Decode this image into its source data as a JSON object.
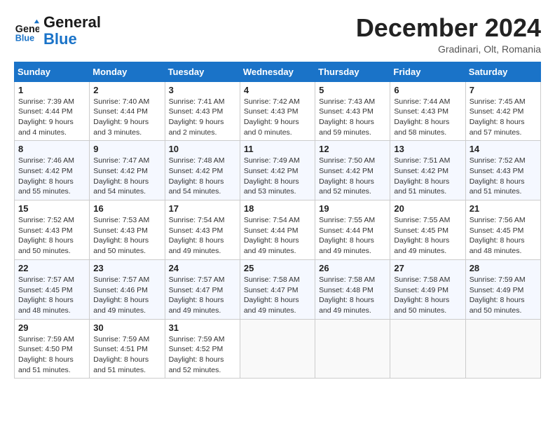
{
  "header": {
    "logo_line1": "General",
    "logo_line2": "Blue",
    "month_title": "December 2024",
    "location": "Gradinari, Olt, Romania"
  },
  "weekdays": [
    "Sunday",
    "Monday",
    "Tuesday",
    "Wednesday",
    "Thursday",
    "Friday",
    "Saturday"
  ],
  "weeks": [
    [
      {
        "day": "1",
        "info": "Sunrise: 7:39 AM\nSunset: 4:44 PM\nDaylight: 9 hours and 4 minutes."
      },
      {
        "day": "2",
        "info": "Sunrise: 7:40 AM\nSunset: 4:44 PM\nDaylight: 9 hours and 3 minutes."
      },
      {
        "day": "3",
        "info": "Sunrise: 7:41 AM\nSunset: 4:43 PM\nDaylight: 9 hours and 2 minutes."
      },
      {
        "day": "4",
        "info": "Sunrise: 7:42 AM\nSunset: 4:43 PM\nDaylight: 9 hours and 0 minutes."
      },
      {
        "day": "5",
        "info": "Sunrise: 7:43 AM\nSunset: 4:43 PM\nDaylight: 8 hours and 59 minutes."
      },
      {
        "day": "6",
        "info": "Sunrise: 7:44 AM\nSunset: 4:43 PM\nDaylight: 8 hours and 58 minutes."
      },
      {
        "day": "7",
        "info": "Sunrise: 7:45 AM\nSunset: 4:42 PM\nDaylight: 8 hours and 57 minutes."
      }
    ],
    [
      {
        "day": "8",
        "info": "Sunrise: 7:46 AM\nSunset: 4:42 PM\nDaylight: 8 hours and 55 minutes."
      },
      {
        "day": "9",
        "info": "Sunrise: 7:47 AM\nSunset: 4:42 PM\nDaylight: 8 hours and 54 minutes."
      },
      {
        "day": "10",
        "info": "Sunrise: 7:48 AM\nSunset: 4:42 PM\nDaylight: 8 hours and 54 minutes."
      },
      {
        "day": "11",
        "info": "Sunrise: 7:49 AM\nSunset: 4:42 PM\nDaylight: 8 hours and 53 minutes."
      },
      {
        "day": "12",
        "info": "Sunrise: 7:50 AM\nSunset: 4:42 PM\nDaylight: 8 hours and 52 minutes."
      },
      {
        "day": "13",
        "info": "Sunrise: 7:51 AM\nSunset: 4:42 PM\nDaylight: 8 hours and 51 minutes."
      },
      {
        "day": "14",
        "info": "Sunrise: 7:52 AM\nSunset: 4:43 PM\nDaylight: 8 hours and 51 minutes."
      }
    ],
    [
      {
        "day": "15",
        "info": "Sunrise: 7:52 AM\nSunset: 4:43 PM\nDaylight: 8 hours and 50 minutes."
      },
      {
        "day": "16",
        "info": "Sunrise: 7:53 AM\nSunset: 4:43 PM\nDaylight: 8 hours and 50 minutes."
      },
      {
        "day": "17",
        "info": "Sunrise: 7:54 AM\nSunset: 4:43 PM\nDaylight: 8 hours and 49 minutes."
      },
      {
        "day": "18",
        "info": "Sunrise: 7:54 AM\nSunset: 4:44 PM\nDaylight: 8 hours and 49 minutes."
      },
      {
        "day": "19",
        "info": "Sunrise: 7:55 AM\nSunset: 4:44 PM\nDaylight: 8 hours and 49 minutes."
      },
      {
        "day": "20",
        "info": "Sunrise: 7:55 AM\nSunset: 4:45 PM\nDaylight: 8 hours and 49 minutes."
      },
      {
        "day": "21",
        "info": "Sunrise: 7:56 AM\nSunset: 4:45 PM\nDaylight: 8 hours and 48 minutes."
      }
    ],
    [
      {
        "day": "22",
        "info": "Sunrise: 7:57 AM\nSunset: 4:45 PM\nDaylight: 8 hours and 48 minutes."
      },
      {
        "day": "23",
        "info": "Sunrise: 7:57 AM\nSunset: 4:46 PM\nDaylight: 8 hours and 49 minutes."
      },
      {
        "day": "24",
        "info": "Sunrise: 7:57 AM\nSunset: 4:47 PM\nDaylight: 8 hours and 49 minutes."
      },
      {
        "day": "25",
        "info": "Sunrise: 7:58 AM\nSunset: 4:47 PM\nDaylight: 8 hours and 49 minutes."
      },
      {
        "day": "26",
        "info": "Sunrise: 7:58 AM\nSunset: 4:48 PM\nDaylight: 8 hours and 49 minutes."
      },
      {
        "day": "27",
        "info": "Sunrise: 7:58 AM\nSunset: 4:49 PM\nDaylight: 8 hours and 50 minutes."
      },
      {
        "day": "28",
        "info": "Sunrise: 7:59 AM\nSunset: 4:49 PM\nDaylight: 8 hours and 50 minutes."
      }
    ],
    [
      {
        "day": "29",
        "info": "Sunrise: 7:59 AM\nSunset: 4:50 PM\nDaylight: 8 hours and 51 minutes."
      },
      {
        "day": "30",
        "info": "Sunrise: 7:59 AM\nSunset: 4:51 PM\nDaylight: 8 hours and 51 minutes."
      },
      {
        "day": "31",
        "info": "Sunrise: 7:59 AM\nSunset: 4:52 PM\nDaylight: 8 hours and 52 minutes."
      },
      null,
      null,
      null,
      null
    ]
  ]
}
